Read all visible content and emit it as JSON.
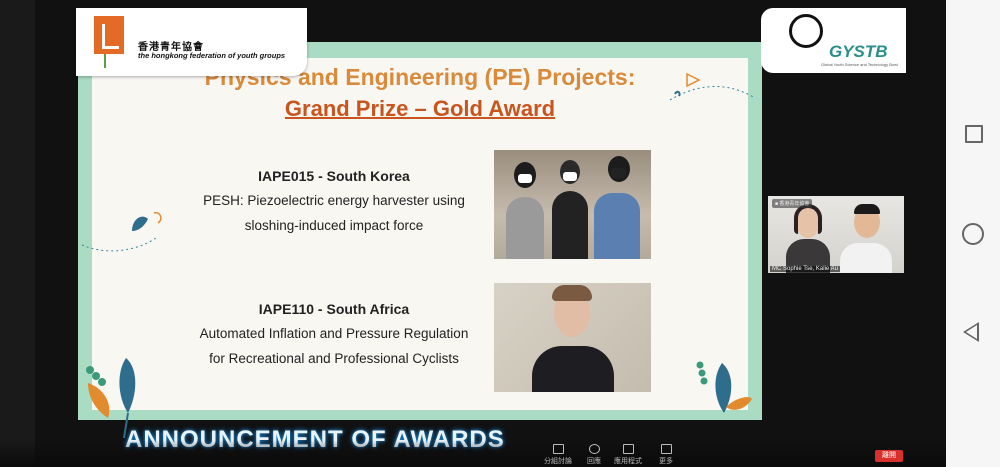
{
  "logos": {
    "hkfyg_chinese": "香港青年協會",
    "hkfyg_english": "the hongkong federation of youth groups",
    "gystb_name": "GYSTB",
    "gystb_tagline": "Global Youth Science and Technology Bowl"
  },
  "slide": {
    "title_line1": "Physics and Engineering (PE) Projects:",
    "title_line2": "Grand Prize – Gold Award",
    "projects": [
      {
        "code": "IAPE015 - South Korea",
        "desc1": "PESH: Piezoelectric energy harvester using",
        "desc2": "sloshing-induced impact force"
      },
      {
        "code": "IAPE110 - South Africa",
        "desc1": "Automated Inflation and Pressure Regulation",
        "desc2": "for Recreational and Professional Cyclists"
      }
    ]
  },
  "banner": "ANNOUNCEMENT OF AWARDS",
  "video": {
    "tag": "■ 香港青年協會",
    "name": "MC Sophie Tse, Kalie Au"
  },
  "toolbar": {
    "buttons": [
      "分組討論",
      "回應",
      "應用程式",
      "更多"
    ],
    "leave": "離開"
  },
  "colors": {
    "slide_border": "#a9dcc3",
    "title_orange": "#d98a3a",
    "title_red_orange": "#c9541e",
    "banner_glow": "#1a8ad0"
  }
}
